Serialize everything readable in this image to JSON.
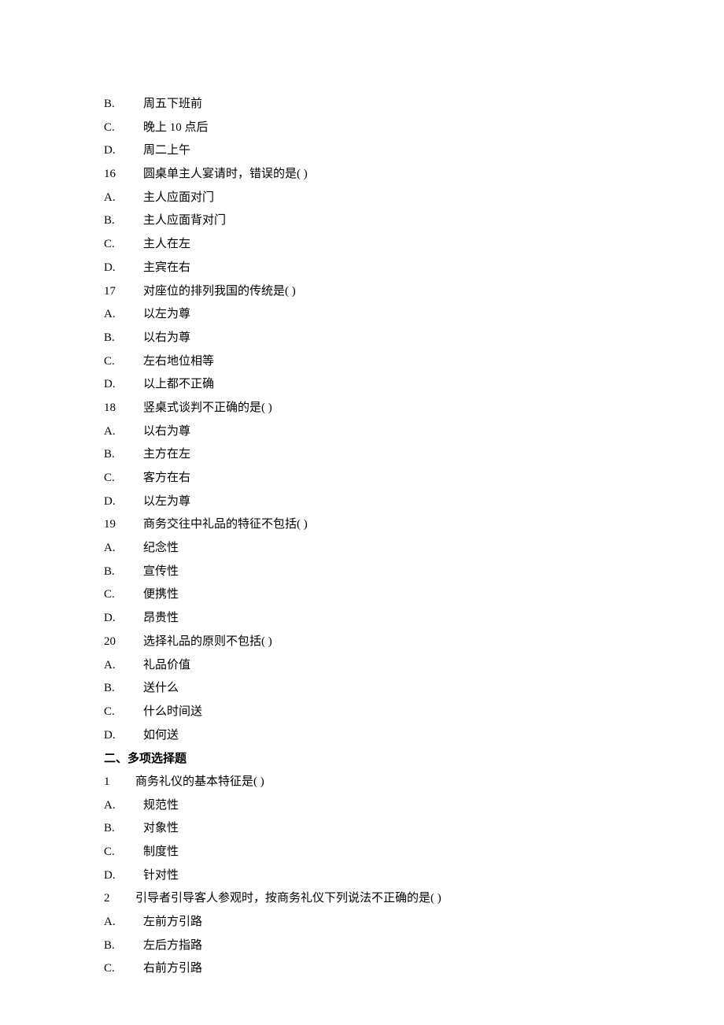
{
  "lines": [
    {
      "type": "option",
      "label": "B.",
      "text": "周五下班前"
    },
    {
      "type": "option",
      "label": "C.",
      "text": "晚上 10 点后"
    },
    {
      "type": "option",
      "label": "D.",
      "text": "周二上午"
    },
    {
      "type": "question",
      "num": "16",
      "text": "圆桌单主人宴请时，错误的是(   )"
    },
    {
      "type": "option",
      "label": "A.",
      "text": "主人应面对门"
    },
    {
      "type": "option",
      "label": "B.",
      "text": "主人应面背对门"
    },
    {
      "type": "option",
      "label": "C.",
      "text": "主人在左"
    },
    {
      "type": "option",
      "label": "D.",
      "text": "主宾在右"
    },
    {
      "type": "question",
      "num": "17",
      "text": "对座位的排列我国的传统是(   )"
    },
    {
      "type": "option",
      "label": "A.",
      "text": "以左为尊"
    },
    {
      "type": "option",
      "label": "B.",
      "text": "以右为尊"
    },
    {
      "type": "option",
      "label": "C.",
      "text": "左右地位相等"
    },
    {
      "type": "option",
      "label": "D.",
      "text": "以上都不正确"
    },
    {
      "type": "question",
      "num": "18",
      "text": "竖桌式谈判不正确的是(   )"
    },
    {
      "type": "option",
      "label": "A.",
      "text": "以右为尊"
    },
    {
      "type": "option",
      "label": "B.",
      "text": "主方在左"
    },
    {
      "type": "option",
      "label": "C.",
      "text": "客方在右"
    },
    {
      "type": "option",
      "label": "D.",
      "text": "以左为尊"
    },
    {
      "type": "question",
      "num": "19",
      "text": "商务交往中礼品的特征不包括(   )"
    },
    {
      "type": "option",
      "label": "A.",
      "text": "纪念性"
    },
    {
      "type": "option",
      "label": "B.",
      "text": "宣传性"
    },
    {
      "type": "option",
      "label": "C.",
      "text": "便携性"
    },
    {
      "type": "option",
      "label": "D.",
      "text": "昂贵性"
    },
    {
      "type": "question",
      "num": "20",
      "text": "选择礼品的原则不包括(   )"
    },
    {
      "type": "option",
      "label": "A.",
      "text": "礼品价值"
    },
    {
      "type": "option",
      "label": "B.",
      "text": "送什么"
    },
    {
      "type": "option",
      "label": "C.",
      "text": "什么时间送"
    },
    {
      "type": "option",
      "label": "D.",
      "text": "如何送"
    },
    {
      "type": "heading",
      "text": "二、多项选择题"
    },
    {
      "type": "question2",
      "num": "1",
      "text": "商务礼仪的基本特征是(   )"
    },
    {
      "type": "option",
      "label": "A.",
      "text": "规范性"
    },
    {
      "type": "option",
      "label": "B.",
      "text": "对象性"
    },
    {
      "type": "option",
      "label": "C.",
      "text": "制度性"
    },
    {
      "type": "option",
      "label": "D.",
      "text": "针对性"
    },
    {
      "type": "question2",
      "num": "2",
      "text": "引导者引导客人参观时，按商务礼仪下列说法不正确的是(   )"
    },
    {
      "type": "option",
      "label": "A.",
      "text": "左前方引路"
    },
    {
      "type": "option",
      "label": "B.",
      "text": "左后方指路"
    },
    {
      "type": "option",
      "label": "C.",
      "text": "右前方引路"
    }
  ]
}
